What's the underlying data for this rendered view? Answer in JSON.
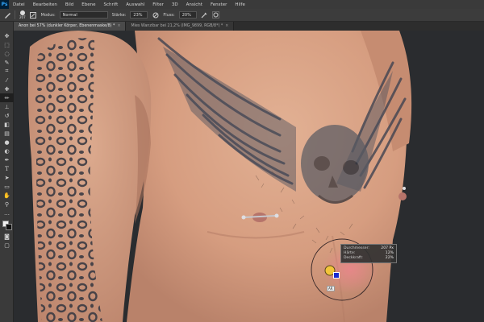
{
  "app": {
    "logo": "Ps",
    "menu": [
      "Datei",
      "Bearbeiten",
      "Bild",
      "Ebene",
      "Schrift",
      "Auswahl",
      "Filter",
      "3D",
      "Ansicht",
      "Fenster",
      "Hilfe"
    ]
  },
  "options": {
    "brush_size": "207",
    "mode_label": "Modus:",
    "mode_value": "Normal",
    "opacity_label": "Stärke:",
    "opacity_value": "23%",
    "flow_label": "Fluss:",
    "flow_value": "20%"
  },
  "tabs": [
    {
      "label": "Anon bei 57% (dunkler Körper, Ebenenmaske/8) *",
      "active": true
    },
    {
      "label": "Mies Wanzibar bei 21,2% (IMG_9899, RGB/8*) *",
      "active": false
    }
  ],
  "brush_info": {
    "diameter_label": "Durchmesser:",
    "diameter_value": "207 Px",
    "hardness_label": "Härte:",
    "hardness_value": "12%",
    "opacity_label": "Deckkraft:",
    "opacity_value": "22%"
  },
  "cursor_label": "AR",
  "colors": {
    "menubar": "#3a3a3a",
    "canvas_bg": "#2a2c2f",
    "skin": "#d9a487",
    "tattoo": "#3d3f48",
    "ps_blue": "#31a8ff"
  }
}
